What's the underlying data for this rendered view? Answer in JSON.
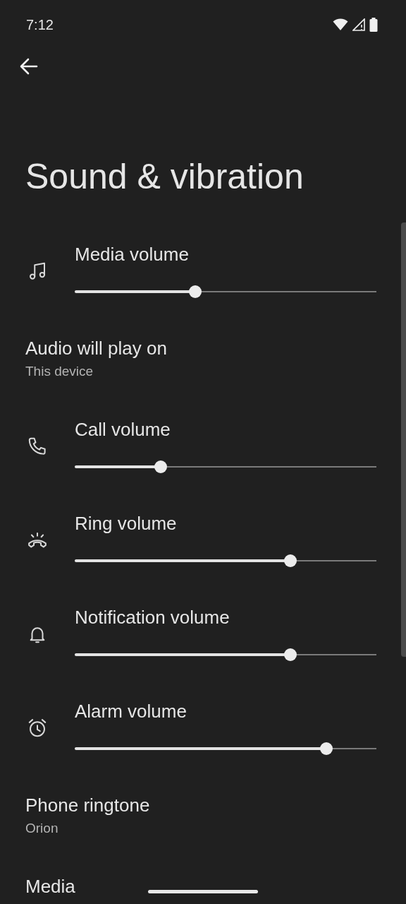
{
  "status_bar": {
    "time": "7:12"
  },
  "title": "Sound & vibration",
  "items": [
    {
      "kind": "slider",
      "title": "Media volume",
      "level": 0.4
    },
    {
      "kind": "text",
      "title": "Audio will play on",
      "subtitle": "This device"
    },
    {
      "kind": "slider",
      "title": "Call volume",
      "level": 0.285
    },
    {
      "kind": "slider",
      "title": "Ring volume",
      "level": 0.715
    },
    {
      "kind": "slider",
      "title": "Notification volume",
      "level": 0.715
    },
    {
      "kind": "slider",
      "title": "Alarm volume",
      "level": 0.834
    },
    {
      "kind": "text",
      "title": "Phone ringtone",
      "subtitle": "Orion"
    },
    {
      "kind": "text",
      "title": "Media"
    }
  ]
}
